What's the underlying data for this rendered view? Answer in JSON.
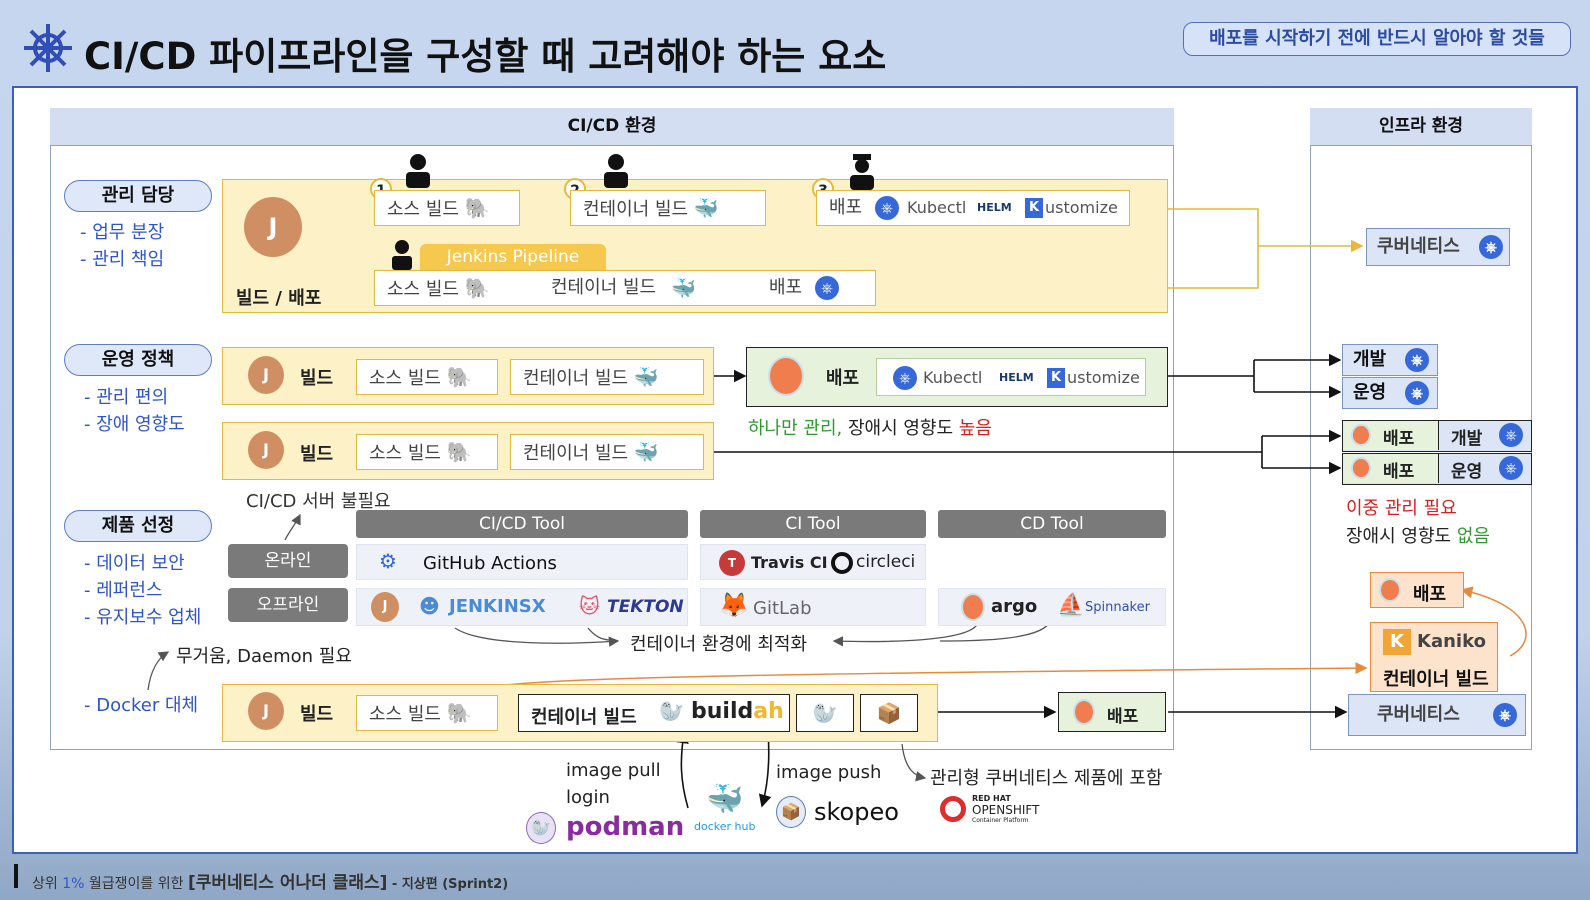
{
  "title": "CI/CD 파이프라인을 구성할 때 고려해야 하는 요소",
  "top_chip": "배포를 시작하기 전에 반드시 알아야 할 것들",
  "cicd_env": "CI/CD 환경",
  "infra_env": "인프라 환경",
  "sections": {
    "mgmt": {
      "label": "관리 담당",
      "items": [
        "- 업무 분장",
        "- 관리 책임"
      ]
    },
    "ops": {
      "label": "운영 정책",
      "items": [
        "- 관리 편의",
        "- 장애 영향도"
      ]
    },
    "product": {
      "label": "제품 선정",
      "items": [
        "- 데이터 보안",
        "- 레퍼런스",
        "- 유지보수 업체"
      ]
    },
    "docker": "- Docker 대체"
  },
  "row1": {
    "build_deploy": "빌드 / 배포",
    "source_build": "소스 빌드",
    "container_build": "컨테이너 빌드",
    "deploy": "배포",
    "kubectl": "Kubectl",
    "helm": "HELM",
    "kustomize": "ustomize",
    "nums": [
      "1",
      "2",
      "3"
    ],
    "pipeline": "Jenkins Pipeline",
    "k8s": "쿠버네티스"
  },
  "row2": {
    "build": "빌드",
    "source_build": "소스 빌드",
    "container_build": "컨테이너 빌드",
    "deploy": "배포",
    "kubectl": "Kubectl",
    "helm": "HELM",
    "kustomize": "ustomize",
    "note_a": "하나만 관리,",
    "note_b": " 장애시 영향도 ",
    "note_c": "높음",
    "dev": "개발",
    "prod": "운영"
  },
  "row3": {
    "build": "빌드",
    "source_build": "소스 빌드",
    "container_build": "컨테이너 빌드",
    "deploy": "배포",
    "dev": "개발",
    "prod": "운영",
    "note1": "이중 관리 필요",
    "note2a": "장애시 영향도 ",
    "note2b": "없음",
    "no_server": "CI/CD 서버 불필요"
  },
  "tools": {
    "cicd": "CI/CD  Tool",
    "ci": "CI Tool",
    "cd": "CD Tool",
    "online": "온라인",
    "offline": "오프라인",
    "github": "GitHub Actions",
    "travis": "Travis CI",
    "circleci": "circleci",
    "jenkinsx": "JENKINSX",
    "tekton": "TEKTON",
    "gitlab": "GitLab",
    "argo": "argo",
    "spinnaker": "Spinnaker",
    "optimized": "컨테이너 환경에 최적화"
  },
  "row4": {
    "heavy": "무거움, Daemon 필요",
    "build": "빌드",
    "source_build": "소스 빌드",
    "container_build": "컨테이너 빌드",
    "buildah_a": "build",
    "buildah_b": "ah",
    "deploy": "배포",
    "image_pull": "image pull",
    "login": "login",
    "image_push": "image push",
    "podman": "podman",
    "dockerhub": "docker hub",
    "skopeo": "skopeo",
    "managed": "관리형 쿠버네티스 제품에 포함",
    "openshift1": "RED HAT",
    "openshift2": "OPENSHIFT",
    "openshift3": "Container Platform",
    "kaniko_deploy": "배포",
    "kaniko": "Kaniko",
    "kaniko_build": "컨테이너 빌드",
    "k8s": "쿠버네티스"
  },
  "footer": {
    "a": "상위 ",
    "b": "1%",
    "c": " 월급쟁이를 위한 ",
    "d": "[쿠버네티스 어나더 클래스]",
    "e": " - 지상편 (Sprint2)"
  },
  "colors": {
    "accent": "#3668d9",
    "yellow": "#e6b93c",
    "green": "#2f9a2f",
    "red": "#d21f1f",
    "orange": "#e78a3c"
  }
}
